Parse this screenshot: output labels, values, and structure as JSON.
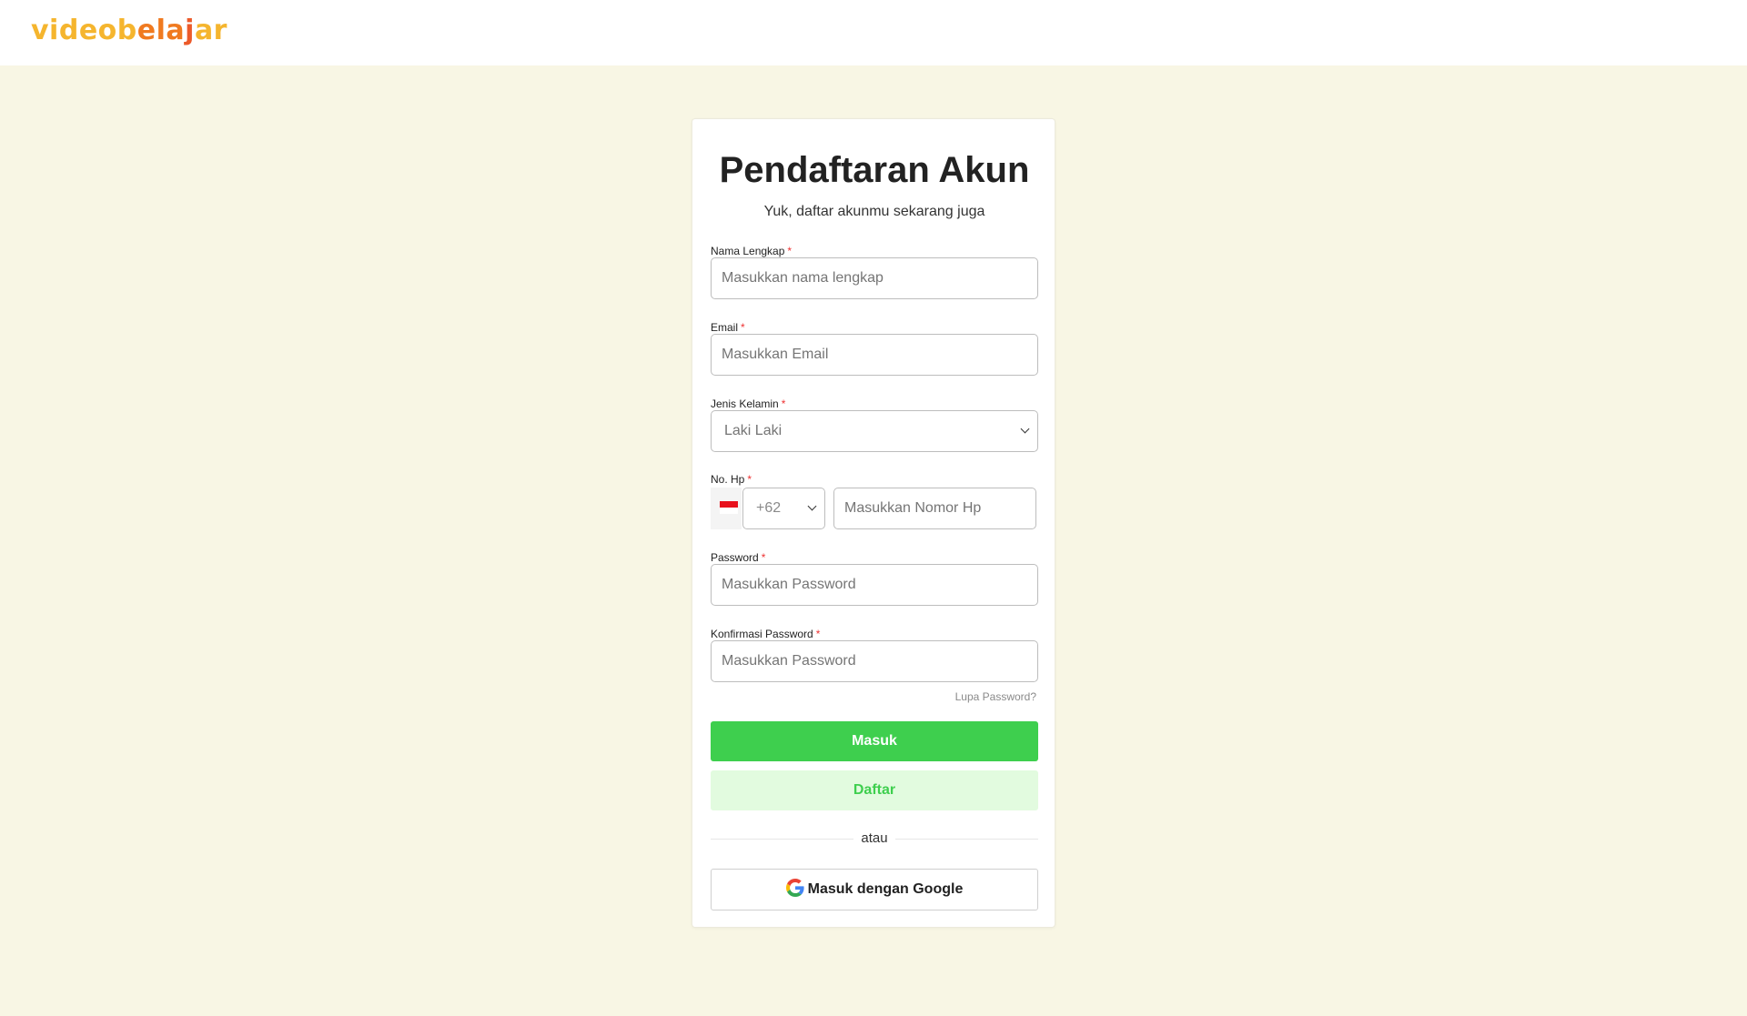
{
  "brand": {
    "logo_text_1": "videob",
    "logo_text_2": "e",
    "logo_text_3": "la",
    "logo_text_4": "j",
    "logo_text_5": "ar"
  },
  "form": {
    "title": "Pendaftaran Akun",
    "subtitle": "Yuk, daftar akunmu sekarang juga",
    "required_mark": "*",
    "name": {
      "label": "Nama Lengkap",
      "placeholder": "Masukkan nama lengkap"
    },
    "email": {
      "label": "Email",
      "placeholder": "Masukkan Email"
    },
    "gender": {
      "label": "Jenis Kelamin",
      "value": "Laki Laki"
    },
    "phone": {
      "label": "No. Hp",
      "country_code": "+62",
      "placeholder": "Masukkan Nomor Hp"
    },
    "password": {
      "label": "Password",
      "placeholder": "Masukkan Password"
    },
    "confirm_password": {
      "label": "Konfirmasi Password",
      "placeholder": "Masukkan Password"
    },
    "forgot_link": "Lupa Password?",
    "login_button": "Masuk",
    "register_button": "Daftar",
    "divider": "atau",
    "google_button": "Masuk dengan Google"
  },
  "colors": {
    "background": "#f8f6e4",
    "primary_green": "#3ecf4e",
    "secondary_green_bg": "#e2fbdf",
    "logo_yellow": "#f5b52e",
    "logo_orange": "#f07a20",
    "required_red": "#e33333"
  },
  "icons": [
    "google-icon",
    "indonesia-flag-icon",
    "chevron-down-icon"
  ]
}
